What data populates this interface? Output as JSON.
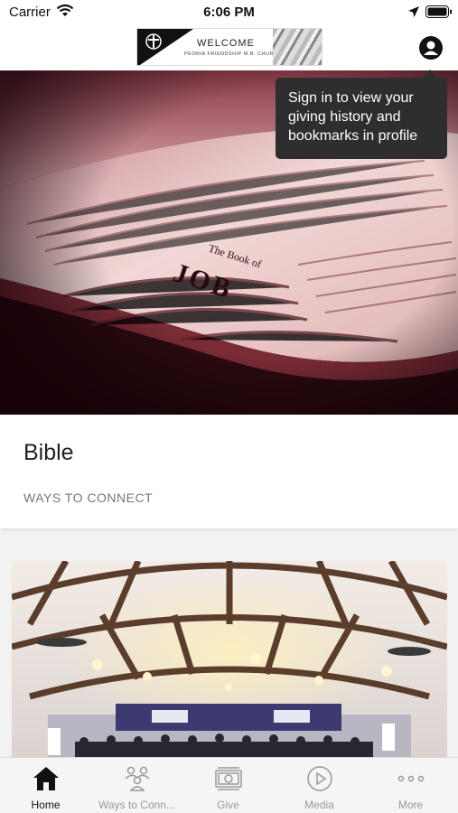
{
  "status_bar": {
    "carrier": "Carrier",
    "time": "6:06 PM"
  },
  "header": {
    "logo": {
      "welcome": "WELCOME",
      "church": "PEORIA FRIENDSHIP M.B. CHURCH"
    }
  },
  "tooltip": {
    "text": "Sign in to view your giving history and bookmarks in profile"
  },
  "hero": {
    "book_heading": "The Book of JOB"
  },
  "cards": [
    {
      "title": "Bible",
      "subtitle": "WAYS TO CONNECT"
    }
  ],
  "tabs": [
    {
      "label": "Home",
      "icon": "home-icon",
      "active": true
    },
    {
      "label": "Ways to Conn...",
      "icon": "people-icon",
      "active": false
    },
    {
      "label": "Give",
      "icon": "money-icon",
      "active": false
    },
    {
      "label": "Media",
      "icon": "play-circle-icon",
      "active": false
    },
    {
      "label": "More",
      "icon": "more-dots-icon",
      "active": false
    }
  ],
  "colors": {
    "tooltip_bg": "#2e2e2e",
    "tab_active": "#111111",
    "tab_inactive": "#999999"
  }
}
